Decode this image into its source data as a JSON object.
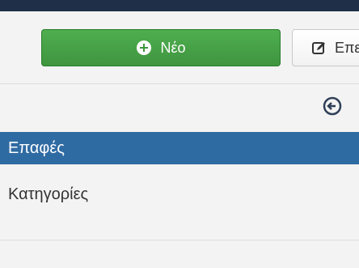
{
  "toolbar": {
    "new_label": "Νέο",
    "edit_label": "Επεξεργασία"
  },
  "sidebar": {
    "items": [
      {
        "label": "Επαφές",
        "active": true
      },
      {
        "label": "Κατηγορίες",
        "active": false
      }
    ]
  },
  "icons": {
    "new": "plus-circle-icon",
    "edit": "edit-icon",
    "collapse": "arrow-left-circle-icon"
  },
  "colors": {
    "header_border": "#1f2f48",
    "new_button": "#46a546",
    "active_item": "#2f6ba3",
    "background": "#f3f3f3"
  }
}
